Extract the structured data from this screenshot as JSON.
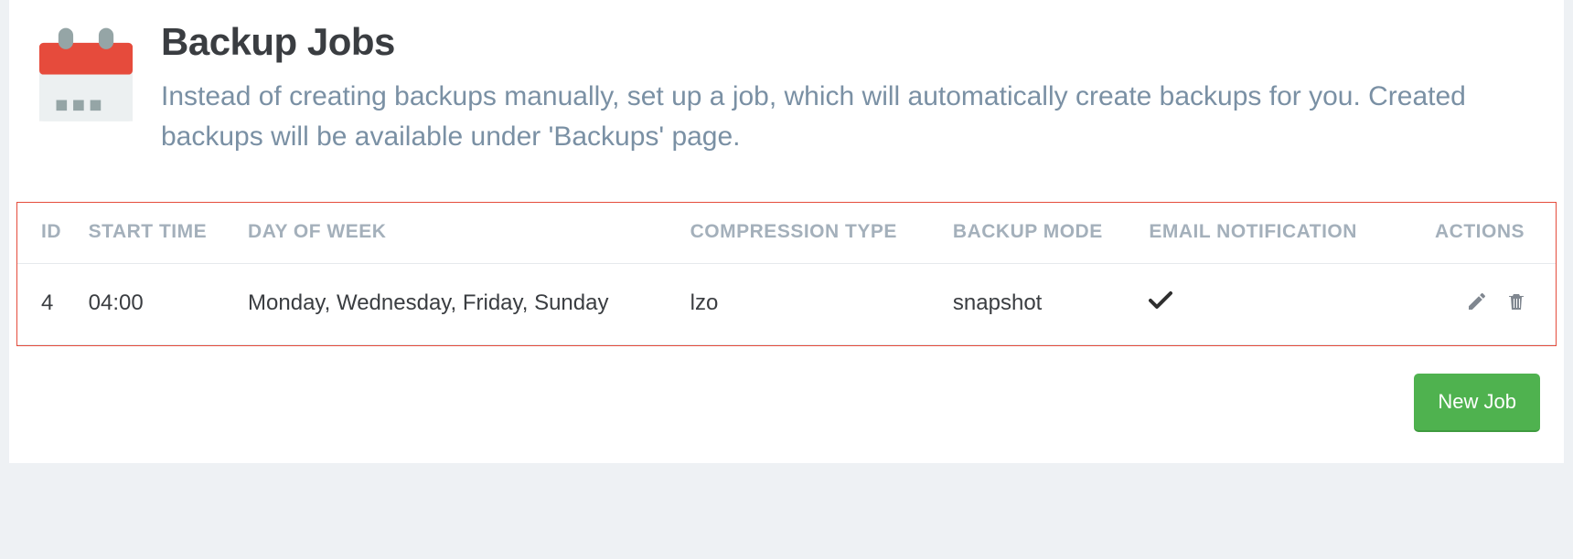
{
  "header": {
    "title": "Backup Jobs",
    "subtitle": "Instead of creating backups manually, set up a job, which will automatically create backups for you. Created backups will be available under 'Backups' page."
  },
  "table": {
    "columns": {
      "id": "ID",
      "start_time": "START TIME",
      "day_of_week": "DAY OF WEEK",
      "compression_type": "COMPRESSION TYPE",
      "backup_mode": "BACKUP MODE",
      "email_notification": "EMAIL NOTIFICATION",
      "actions": "ACTIONS"
    },
    "rows": [
      {
        "id": "4",
        "start_time": "04:00",
        "day_of_week": "Monday, Wednesday, Friday, Sunday",
        "compression_type": "lzo",
        "backup_mode": "snapshot",
        "email_notification": true
      }
    ]
  },
  "buttons": {
    "new_job": "New Job"
  }
}
